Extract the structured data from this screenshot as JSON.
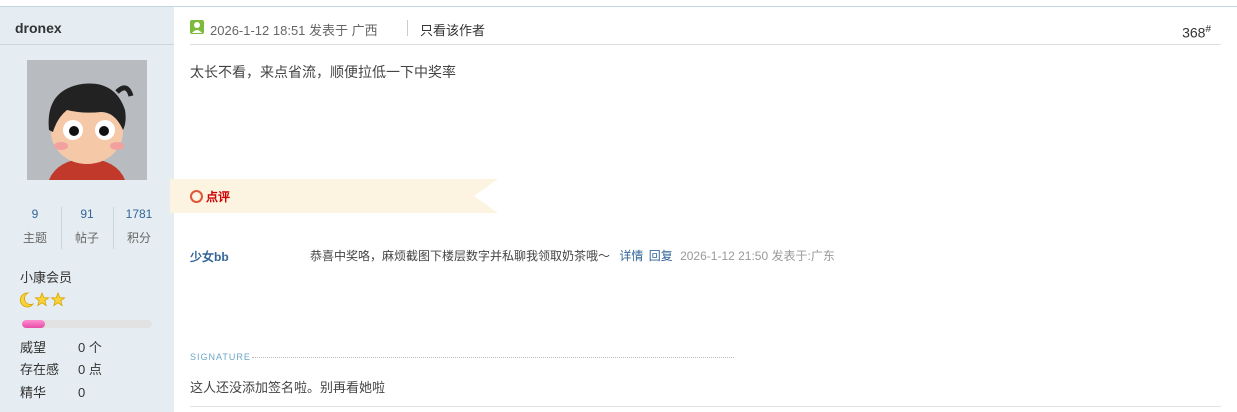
{
  "author": {
    "name": "dronex",
    "stats": [
      {
        "value": "9",
        "label": "主题"
      },
      {
        "value": "91",
        "label": "帖子"
      },
      {
        "value": "1781",
        "label": "积分"
      }
    ],
    "rank": "小康会员",
    "level_progress": 0.18,
    "attributes": [
      {
        "key": "威望",
        "value": "0 个"
      },
      {
        "key": "存在感",
        "value": "0 点"
      },
      {
        "key": "精华",
        "value": "0"
      }
    ]
  },
  "post": {
    "time": "2026-1-12 18:51 发表于 广西",
    "only_author": "只看该作者",
    "floor": "368",
    "floor_mark": "#",
    "content": "太长不看，来点省流，顺便拉低一下中奖率"
  },
  "comment_section": {
    "label": "点评",
    "comments": [
      {
        "user": "少女bb",
        "text": "恭喜中奖咯，麻烦截图下楼层数字并私聊我领取奶茶哦～",
        "detail": "详情",
        "reply": "回复",
        "meta": "2026-1-12 21:50 发表于:广东"
      }
    ]
  },
  "signature": {
    "label": "SIGNATURE",
    "text": "这人还没添加签名啦。别再看她啦"
  }
}
